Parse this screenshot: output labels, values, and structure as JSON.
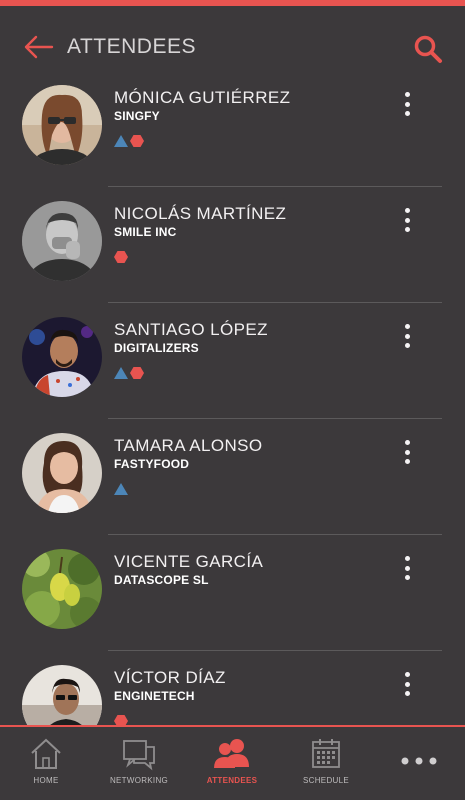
{
  "header": {
    "title": "ATTENDEES",
    "back_icon": "arrow-left-icon",
    "search_icon": "search-icon"
  },
  "colors": {
    "accent": "#e85450",
    "background": "#3c393b",
    "badge_blue": "#4c86b8",
    "badge_red": "#e85450"
  },
  "attendees": [
    {
      "name": "MÓNICA GUTIÉRREZ",
      "company": "SINGFY",
      "badges": [
        "triangle",
        "hexagon"
      ]
    },
    {
      "name": "NICOLÁS MARTÍNEZ",
      "company": "SMILE INC",
      "badges": [
        "hexagon"
      ]
    },
    {
      "name": "SANTIAGO LÓPEZ",
      "company": "DIGITALIZERS",
      "badges": [
        "triangle",
        "hexagon"
      ]
    },
    {
      "name": "TAMARA ALONSO",
      "company": "FASTYFOOD",
      "badges": [
        "triangle"
      ]
    },
    {
      "name": "VICENTE GARCÍA",
      "company": "DATASCOPE SL",
      "badges": []
    },
    {
      "name": "VÍCTOR DÍAZ",
      "company": "ENGINETECH",
      "badges": [
        "hexagon"
      ]
    }
  ],
  "nav": {
    "items": [
      {
        "label": "HOME",
        "icon": "home-icon",
        "active": false
      },
      {
        "label": "NETWORKING",
        "icon": "chat-icon",
        "active": false
      },
      {
        "label": "ATTENDEES",
        "icon": "people-icon",
        "active": true
      },
      {
        "label": "SCHEDULE",
        "icon": "calendar-icon",
        "active": false
      },
      {
        "label": "",
        "icon": "more-horizontal-icon",
        "active": false
      }
    ]
  }
}
